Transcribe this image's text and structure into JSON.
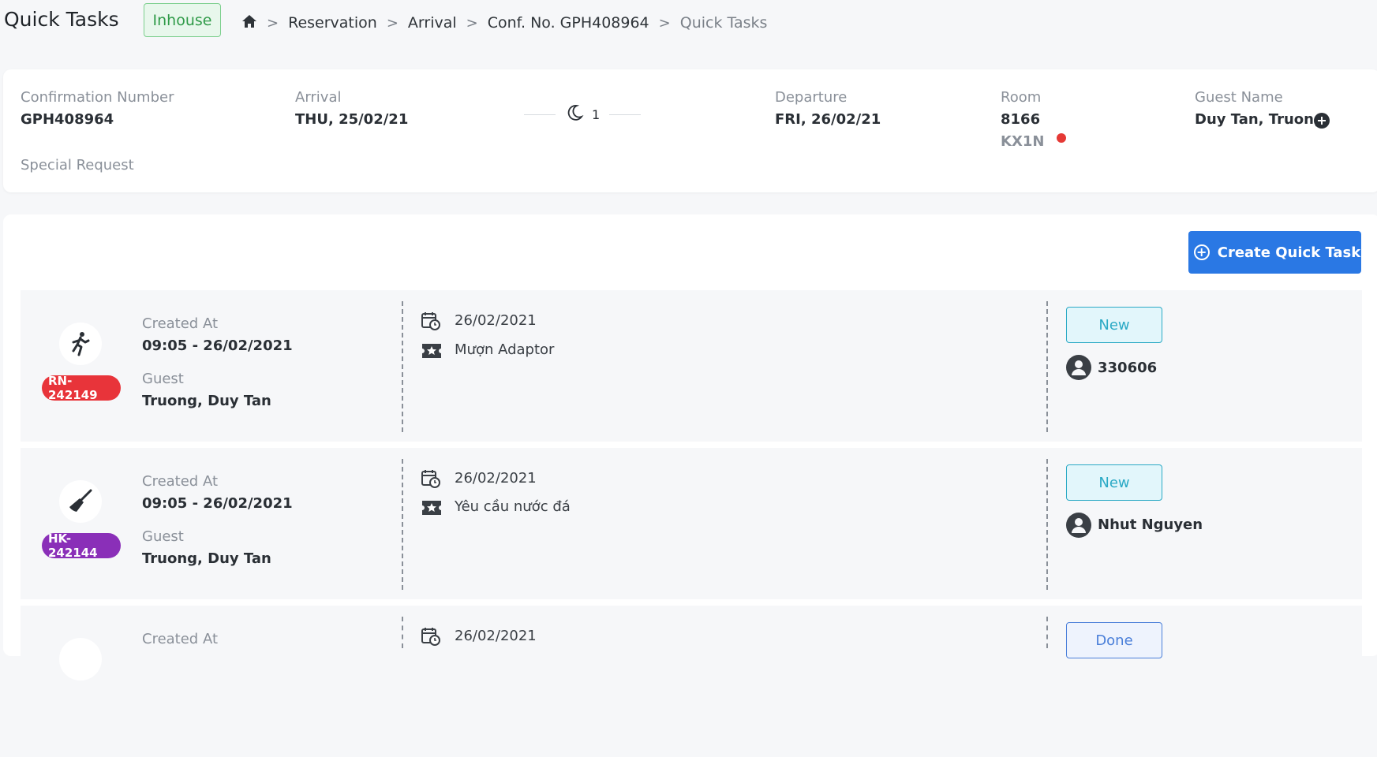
{
  "header": {
    "title": "Quick Tasks",
    "status": "Inhouse",
    "breadcrumb": [
      "Reservation",
      "Arrival",
      "Conf. No. GPH408964",
      "Quick Tasks"
    ]
  },
  "reservation": {
    "confirmation_label": "Confirmation Number",
    "confirmation_value": "GPH408964",
    "arrival_label": "Arrival",
    "arrival_value": "THU, 25/02/21",
    "nights": "1",
    "departure_label": "Departure",
    "departure_value": "FRI, 26/02/21",
    "room_label": "Room",
    "room_number": "8166",
    "room_type": "KX1N",
    "guest_label": "Guest Name",
    "guest_value": "Duy Tan, Truong",
    "special_request_label": "Special Request"
  },
  "actions": {
    "create_label": "Create Quick Task"
  },
  "tasks": [
    {
      "department_icon": "running-person-icon",
      "badge": "RN-242149",
      "badge_color": "#e8343a",
      "created_label": "Created At",
      "created_value": "09:05 - 26/02/2021",
      "guest_label": "Guest",
      "guest_value": "Truong, Duy Tan",
      "date": "26/02/2021",
      "item": "Mượn Adaptor",
      "status": "New",
      "assignee": "330606"
    },
    {
      "department_icon": "broom-icon",
      "badge": "HK-242144",
      "badge_color": "#8a2fb8",
      "created_label": "Created At",
      "created_value": "09:05 - 26/02/2021",
      "guest_label": "Guest",
      "guest_value": "Truong, Duy Tan",
      "date": "26/02/2021",
      "item": "Yêu cầu nước đá",
      "status": "New",
      "assignee": "Nhut Nguyen"
    },
    {
      "created_label": "Created At",
      "date": "26/02/2021",
      "status": "Done"
    }
  ]
}
